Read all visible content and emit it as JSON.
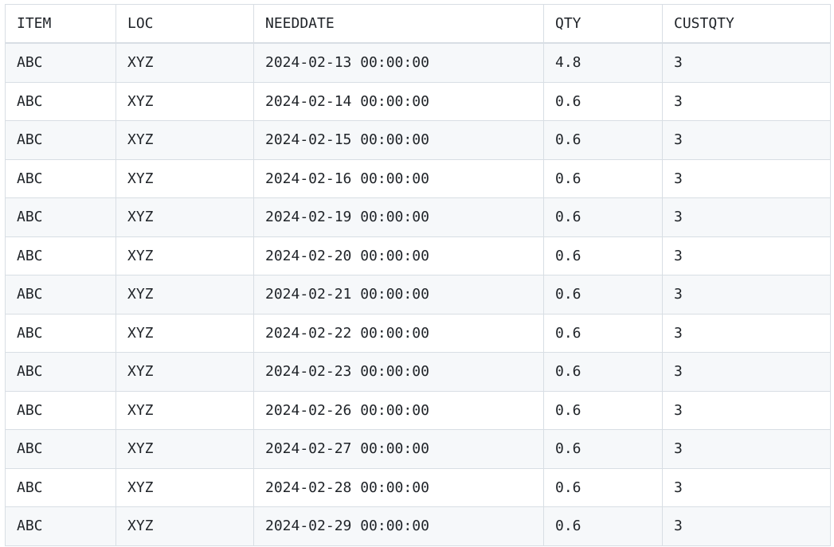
{
  "table": {
    "headers": [
      "ITEM",
      "LOC",
      "NEEDDATE",
      "QTY",
      "CUSTQTY"
    ],
    "rows": [
      [
        "ABC",
        "XYZ",
        "2024-02-13 00:00:00",
        "4.8",
        "3"
      ],
      [
        "ABC",
        "XYZ",
        "2024-02-14 00:00:00",
        "0.6",
        "3"
      ],
      [
        "ABC",
        "XYZ",
        "2024-02-15 00:00:00",
        "0.6",
        "3"
      ],
      [
        "ABC",
        "XYZ",
        "2024-02-16 00:00:00",
        "0.6",
        "3"
      ],
      [
        "ABC",
        "XYZ",
        "2024-02-19 00:00:00",
        "0.6",
        "3"
      ],
      [
        "ABC",
        "XYZ",
        "2024-02-20 00:00:00",
        "0.6",
        "3"
      ],
      [
        "ABC",
        "XYZ",
        "2024-02-21 00:00:00",
        "0.6",
        "3"
      ],
      [
        "ABC",
        "XYZ",
        "2024-02-22 00:00:00",
        "0.6",
        "3"
      ],
      [
        "ABC",
        "XYZ",
        "2024-02-23 00:00:00",
        "0.6",
        "3"
      ],
      [
        "ABC",
        "XYZ",
        "2024-02-26 00:00:00",
        "0.6",
        "3"
      ],
      [
        "ABC",
        "XYZ",
        "2024-02-27 00:00:00",
        "0.6",
        "3"
      ],
      [
        "ABC",
        "XYZ",
        "2024-02-28 00:00:00",
        "0.6",
        "3"
      ],
      [
        "ABC",
        "XYZ",
        "2024-02-29 00:00:00",
        "0.6",
        "3"
      ]
    ]
  },
  "colors": {
    "border": "#d8dee4",
    "stripe": "#f6f8fa",
    "text": "#1f2328"
  }
}
